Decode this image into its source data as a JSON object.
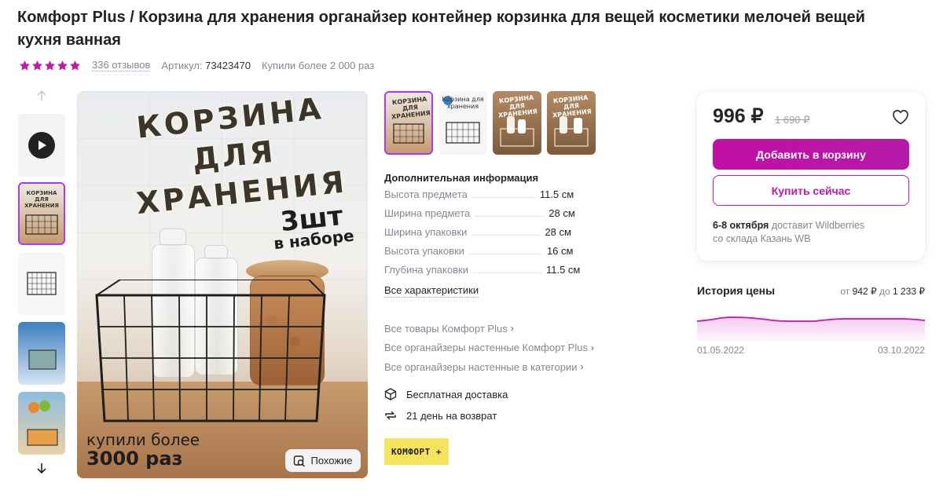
{
  "product": {
    "title": "Комфорт Plus / Корзина для хранения органайзер контейнер корзинка для вещей косметики мелочей вещей кухня ванная",
    "rating_stars": 5,
    "reviews": "336 отзывов",
    "article_label": "Артикул:",
    "article_value": "73423470",
    "bought": "Купили более 2 000 раз"
  },
  "colors": {
    "accent": "#cb11ab",
    "star": "#cb11ab",
    "active_thumb_border": "#a73afd"
  },
  "main_image": {
    "headline": "КОРЗИНА ДЛЯ ХРАНЕНИЯ",
    "badge_big": "3шт",
    "badge_small": "в наборе",
    "bought_line1": "купили более",
    "bought_line2": "3000 раз",
    "similar_button": "Похожие",
    "similar_icon": "search-image-icon"
  },
  "thumbs_gallery": [
    {
      "caption": "КОРЗИНА ДЛЯ ХРАНЕНИЯ"
    },
    {
      "caption": "Корзина для хранения"
    },
    {
      "caption": "КОРЗИНА ДЛЯ ХРАНЕНИЯ"
    },
    {
      "caption": "КОРЗИНА ДЛЯ ХРАНЕНИЯ"
    }
  ],
  "additional_info": {
    "heading": "Дополнительная информация",
    "specs": [
      {
        "name": "Высота предмета",
        "value": "11.5 см"
      },
      {
        "name": "Ширина предмета",
        "value": "28 см"
      },
      {
        "name": "Ширина упаковки",
        "value": "28 см"
      },
      {
        "name": "Высота упаковки",
        "value": "16 см"
      },
      {
        "name": "Глубина упаковки",
        "value": "11.5 см"
      }
    ],
    "all_specs": "Все характеристики"
  },
  "links": [
    "Все товары Комфорт Plus",
    "Все органайзеры настенные Комфорт Plus",
    "Все органайзеры настенные в категории"
  ],
  "features": [
    {
      "icon": "box-icon",
      "label": "Бесплатная доставка"
    },
    {
      "icon": "return-icon",
      "label": "21 день на возврат"
    }
  ],
  "brand_logo": "КОМФОРТ +",
  "buy_card": {
    "price": "996 ₽",
    "old_price": "1 690 ₽",
    "add_to_cart": "Добавить в корзину",
    "buy_now": "Купить сейчас",
    "delivery_date": "6-8 октября",
    "delivery_text": " доставит Wildberries",
    "delivery_warehouse": "со склада Казань WB"
  },
  "price_history": {
    "title": "История цены",
    "from_label": "от",
    "min_price": "942 ₽",
    "to_label": "до",
    "max_price": "1 233 ₽",
    "start_date": "01.05.2022",
    "end_date": "03.10.2022"
  }
}
